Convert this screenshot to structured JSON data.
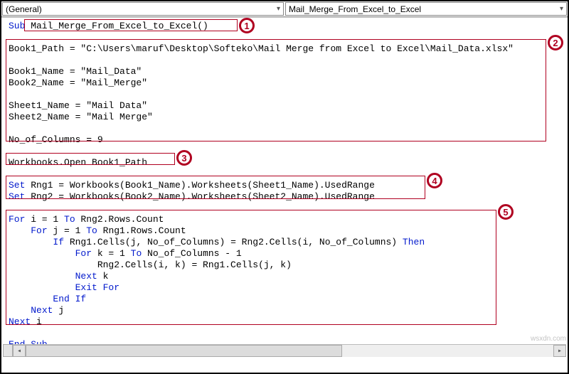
{
  "dropdowns": {
    "left": "(General)",
    "right": "Mail_Merge_From_Excel_to_Excel"
  },
  "code": {
    "sub_kw": "Sub",
    "sub_name": " Mail_Merge_From_Excel_to_Excel()",
    "l_path": "Book1_Path = \"C:\\Users\\maruf\\Desktop\\Softeko\\Mail Merge from Excel to Excel\\Mail_Data.xlsx\"",
    "l_b1n": "Book1_Name = \"Mail_Data\"",
    "l_b2n": "Book2_Name = \"Mail_Merge\"",
    "l_s1n": "Sheet1_Name = \"Mail Data\"",
    "l_s2n": "Sheet2_Name = \"Mail Merge\"",
    "l_cols": "No_of_Columns = 9",
    "l_open": "Workbooks.Open Book1_Path",
    "set_kw1": "Set",
    "l_rng1": " Rng1 = Workbooks(Book1_Name).Worksheets(Sheet1_Name).UsedRange",
    "set_kw2": "Set",
    "l_rng2": " Rng2 = Workbooks(Book2_Name).Worksheets(Sheet2_Name).UsedRange",
    "for_kw": "For",
    "to_kw": "To",
    "if_kw": "If",
    "then_kw": "Then",
    "next_kw": "Next",
    "exit_for": "Exit For",
    "end_if": "End If",
    "end_sub": "End Sub",
    "for_i_a": " i = 1 ",
    "for_i_b": " Rng2.Rows.Count",
    "for_j_a": " j = 1 ",
    "for_j_b": " Rng1.Rows.Count",
    "if_a": " Rng1.Cells(j, No_of_Columns) = Rng2.Cells(i, No_of_Columns) ",
    "for_k_a": " k = 1 ",
    "for_k_b": " No_of_Columns - 1",
    "assign": "Rng2.Cells(i, k) = Rng1.Cells(j, k)",
    "next_k": " k",
    "next_j": " j",
    "next_i": " i"
  },
  "callouts": {
    "c1": "1",
    "c2": "2",
    "c3": "3",
    "c4": "4",
    "c5": "5"
  },
  "watermark": "wsxdn.com"
}
